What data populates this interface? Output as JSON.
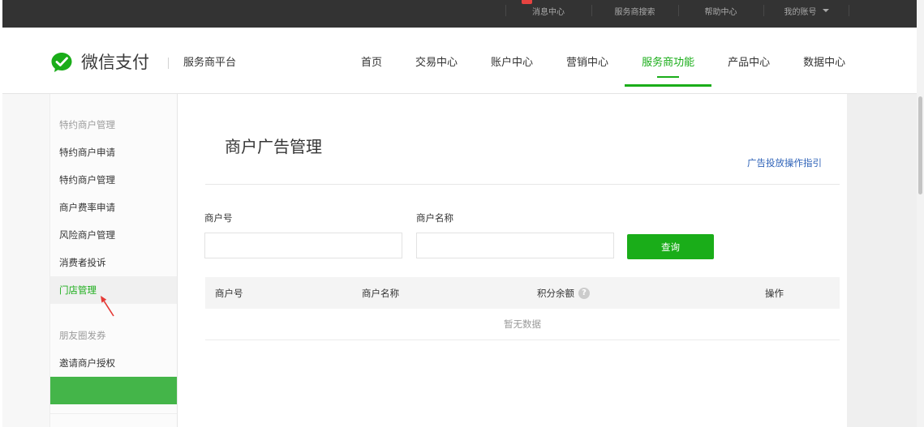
{
  "colors": {
    "brand_green": "#1aad19",
    "menu_active_green": "#44b549",
    "link_blue": "#2f63b8",
    "topbar_bg": "#333333",
    "badge_red": "#e64340",
    "annotation_red": "#e53935"
  },
  "topbar": {
    "items": [
      {
        "label": "消息中心",
        "badge": true
      },
      {
        "label": "服务商搜索"
      },
      {
        "label": "帮助中心"
      },
      {
        "label": "我的账号",
        "icon": "caret-down-icon"
      }
    ]
  },
  "header": {
    "logo_icon": "wechat-pay-logo-icon",
    "brand": "微信支付",
    "platform": "服务商平台",
    "nav": [
      {
        "label": "首页",
        "active": false
      },
      {
        "label": "交易中心",
        "active": false
      },
      {
        "label": "账户中心",
        "active": false
      },
      {
        "label": "营销中心",
        "active": false
      },
      {
        "label": "服务商功能",
        "active": true
      },
      {
        "label": "产品中心",
        "active": false
      },
      {
        "label": "数据中心",
        "active": false
      }
    ]
  },
  "sidebar": {
    "groups": [
      {
        "title": "特约商户管理",
        "items": [
          {
            "label": "特约商户申请"
          },
          {
            "label": "特约商户管理"
          },
          {
            "label": "商户费率申请"
          },
          {
            "label": "风险商户管理"
          },
          {
            "label": "消费者投诉"
          },
          {
            "label": "门店管理",
            "highlighted": true
          }
        ]
      },
      {
        "title": "朋友圈发券",
        "items": [
          {
            "label": "邀请商户授权"
          },
          {
            "active": true
          }
        ]
      }
    ]
  },
  "main": {
    "title": "商户广告管理",
    "guide_link": "广告投放操作指引",
    "filters": {
      "merchant_id": {
        "label": "商户号",
        "value": ""
      },
      "merchant_name": {
        "label": "商户名称",
        "value": ""
      }
    },
    "search_button": "查询",
    "table": {
      "columns": [
        {
          "label": "商户号"
        },
        {
          "label": "商户名称"
        },
        {
          "label": "积分余额",
          "icon": "help-icon"
        },
        {
          "label": "操作"
        }
      ],
      "rows": [],
      "empty_text": "暂无数据"
    }
  },
  "annotation": {
    "icon": "red-arrow-icon"
  }
}
